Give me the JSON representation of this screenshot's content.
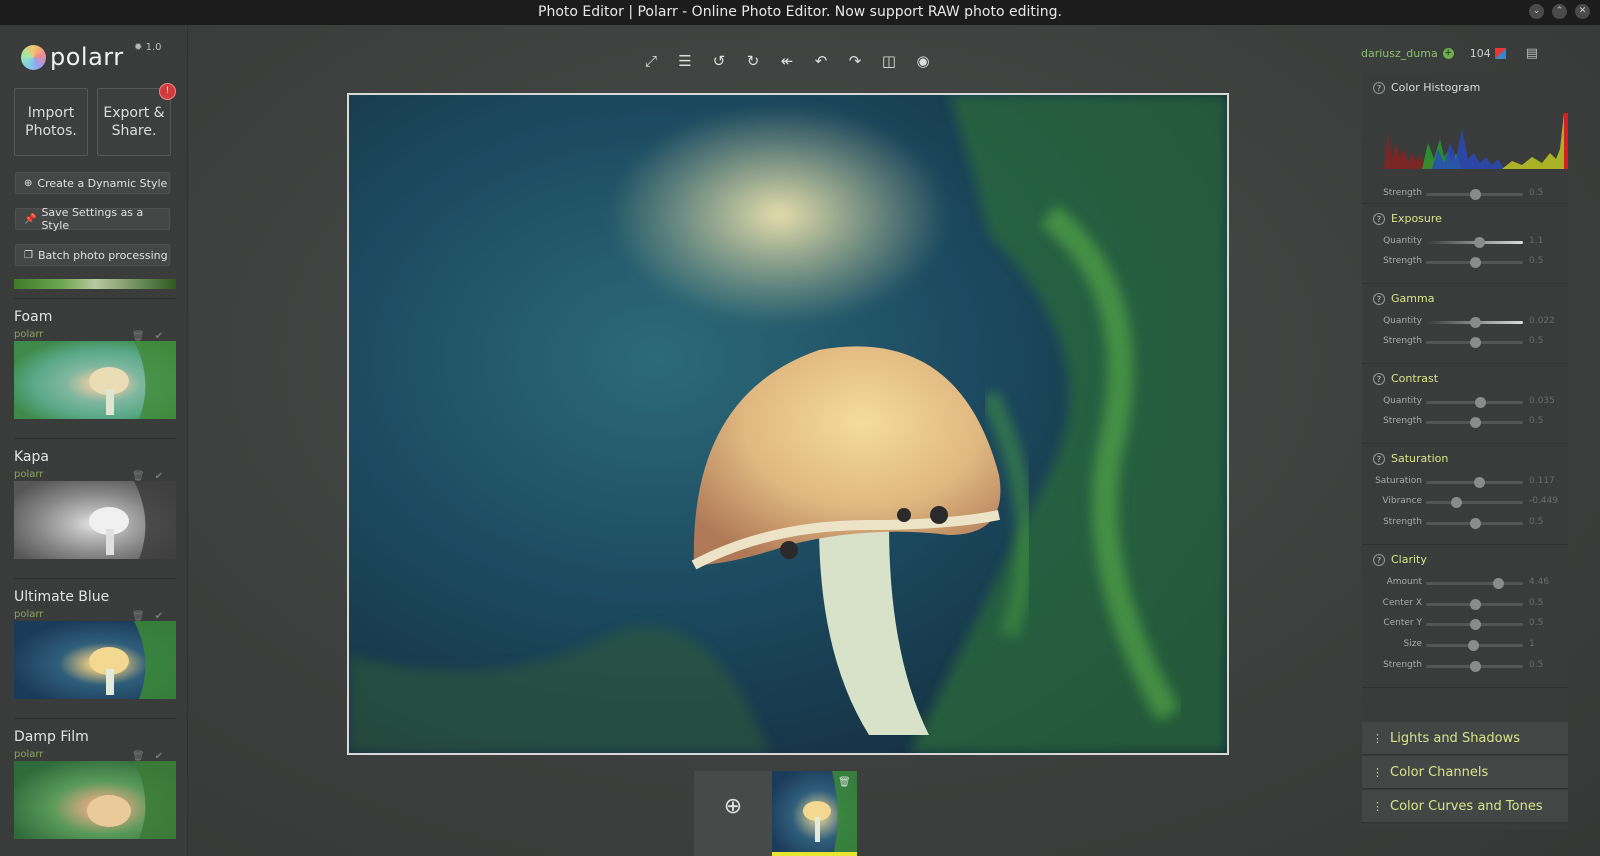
{
  "window": {
    "title": "Photo Editor | Polarr - Online Photo Editor. Now support RAW photo editing."
  },
  "logo": {
    "text": "polarr",
    "version": "1.0"
  },
  "sidebar": {
    "import_label_1": "Import",
    "import_label_2": "Photos.",
    "export_label_1": "Export &",
    "export_label_2": "Share.",
    "export_badge": "!",
    "create_style": "Create a Dynamic Style",
    "save_style": "Save Settings as a Style",
    "batch": "Batch photo processing",
    "styles": [
      {
        "name": "Foam",
        "author": "polarr"
      },
      {
        "name": "Kapa",
        "author": "polarr"
      },
      {
        "name": "Ultimate Blue",
        "author": "polarr"
      },
      {
        "name": "Damp Film",
        "author": "polarr"
      }
    ]
  },
  "user": {
    "name": "dariusz_duma",
    "count": "104"
  },
  "panel": {
    "histogram": {
      "title": "Color Histogram",
      "rows": [
        {
          "label": "Strength",
          "value": "0.5",
          "pos": 0.5
        }
      ]
    },
    "exposure": {
      "title": "Exposure",
      "rows": [
        {
          "label": "Quantity",
          "value": "1.1",
          "pos": 0.55
        },
        {
          "label": "Strength",
          "value": "0.5",
          "pos": 0.5
        }
      ]
    },
    "gamma": {
      "title": "Gamma",
      "rows": [
        {
          "label": "Quantity",
          "value": "0.022",
          "pos": 0.51
        },
        {
          "label": "Strength",
          "value": "0.5",
          "pos": 0.5
        }
      ]
    },
    "contrast": {
      "title": "Contrast",
      "rows": [
        {
          "label": "Quantity",
          "value": "0.035",
          "pos": 0.56
        },
        {
          "label": "Strength",
          "value": "0.5",
          "pos": 0.5
        }
      ]
    },
    "saturation": {
      "title": "Saturation",
      "rows": [
        {
          "label": "Saturation",
          "value": "0.117",
          "pos": 0.55
        },
        {
          "label": "Vibrance",
          "value": "-0.449",
          "pos": 0.31
        },
        {
          "label": "Strength",
          "value": "0.5",
          "pos": 0.5
        }
      ]
    },
    "clarity": {
      "title": "Clarity",
      "rows": [
        {
          "label": "Amount",
          "value": "4.46",
          "pos": 0.74
        },
        {
          "label": "Center X",
          "value": "0.5",
          "pos": 0.5
        },
        {
          "label": "Center Y",
          "value": "0.5",
          "pos": 0.5
        },
        {
          "label": "Size",
          "value": "1",
          "pos": 0.48
        },
        {
          "label": "Strength",
          "value": "0.5",
          "pos": 0.5
        }
      ]
    },
    "collapsed": [
      "Lights and Shadows",
      "Color Channels",
      "Color Curves and Tones"
    ]
  }
}
